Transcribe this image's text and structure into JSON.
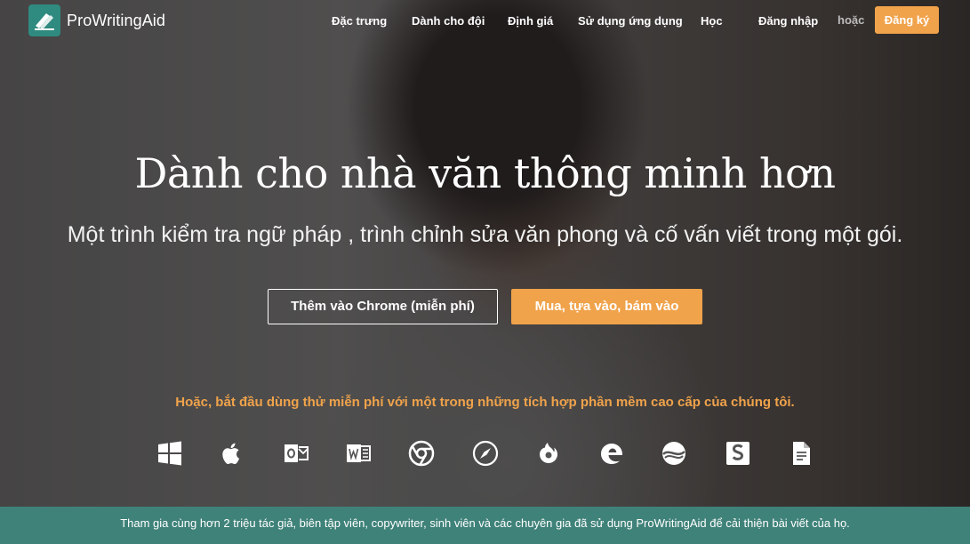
{
  "brand": {
    "name": "ProWritingAid",
    "accent": "#2f8a80",
    "orange": "#f0a34b"
  },
  "nav": {
    "items": [
      "Đặc trưng",
      "Dành cho đội",
      "Định giá",
      "Sử dụng ứng dụng",
      "Học",
      "Đăng nhập"
    ],
    "or_label": "hoặc",
    "signup_label": "Đăng ký"
  },
  "hero": {
    "title": "Dành cho nhà văn thông minh hơn",
    "subtitle": "Một trình kiểm tra ngữ pháp , trình chỉnh sửa văn phong và cố vấn viết trong một gói.",
    "chrome_button": "Thêm vào Chrome (miễn phí)",
    "buy_button": "Mua, tựa vào, bám vào",
    "integrations_text": "Hoặc, bắt đầu dùng thử miễn phí với một trong những tích hợp phần mềm cao cấp của chúng tôi."
  },
  "integrations": [
    "windows-icon",
    "apple-icon",
    "outlook-icon",
    "word-icon",
    "chrome-icon",
    "safari-icon",
    "firefox-icon",
    "edge-icon",
    "scrivener-icon",
    "google-docs-icon",
    "document-icon"
  ],
  "footer": {
    "text": "Tham gia cùng hơn 2 triệu tác giả, biên tập viên, copywriter, sinh viên và các chuyên gia đã sử dụng ProWritingAid để cải thiện bài viết của họ."
  }
}
